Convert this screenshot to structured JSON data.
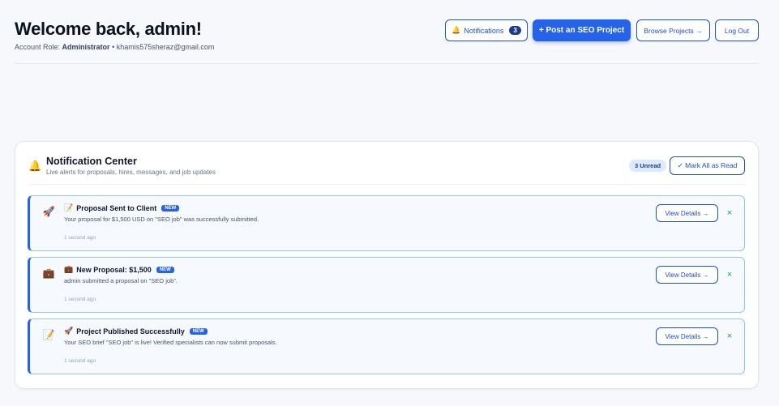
{
  "header": {
    "title": "Welcome back, admin!",
    "role_label": "Account Role:",
    "role_value": "Administrator",
    "separator": "•",
    "email": "khamis575sheraz@gmail.com",
    "buttons": {
      "notifications_icon": "🔔",
      "notifications_label": "Notifications",
      "notifications_count": "3",
      "post_project": "+ Post an SEO Project",
      "browse_projects": "Browse Projects →",
      "logout": "Log Out"
    }
  },
  "notification_center": {
    "icon": "🔔",
    "title": "Notification Center",
    "subtitle": "Live alerts for proposals, hires, messages, and job updates",
    "unread_badge": "3 Unread",
    "mark_all_read": "✓ Mark All as Read",
    "items": [
      {
        "icon": "🚀",
        "title_emoji": "📝",
        "title": "Proposal Sent to Client",
        "badge": "NEW",
        "message": "Your proposal for $1,500 USD on \"SEO job\" was successfully submitted.",
        "time": "1 second ago",
        "action": "View Details →",
        "dismiss": "×"
      },
      {
        "icon": "💼",
        "title_emoji": "💼",
        "title": "New Proposal: $1,500",
        "badge": "NEW",
        "message": "admin submitted a proposal on \"SEO job\".",
        "time": "1 second ago",
        "action": "View Details →",
        "dismiss": "×"
      },
      {
        "icon": "📝",
        "title_emoji": "🚀",
        "title": "Project Published Successfully",
        "badge": "NEW",
        "message": "Your SEO brief \"SEO job\" is live! Verified specialists can now submit proposals.",
        "time": "1 second ago",
        "action": "View Details →",
        "dismiss": "×"
      }
    ]
  },
  "colors": {
    "accent": "#2563eb",
    "accent_dark": "#1d4ed8",
    "badge_bg": "#dbeafe",
    "bell": "#f59e0b",
    "dismiss": "#16a34a"
  }
}
